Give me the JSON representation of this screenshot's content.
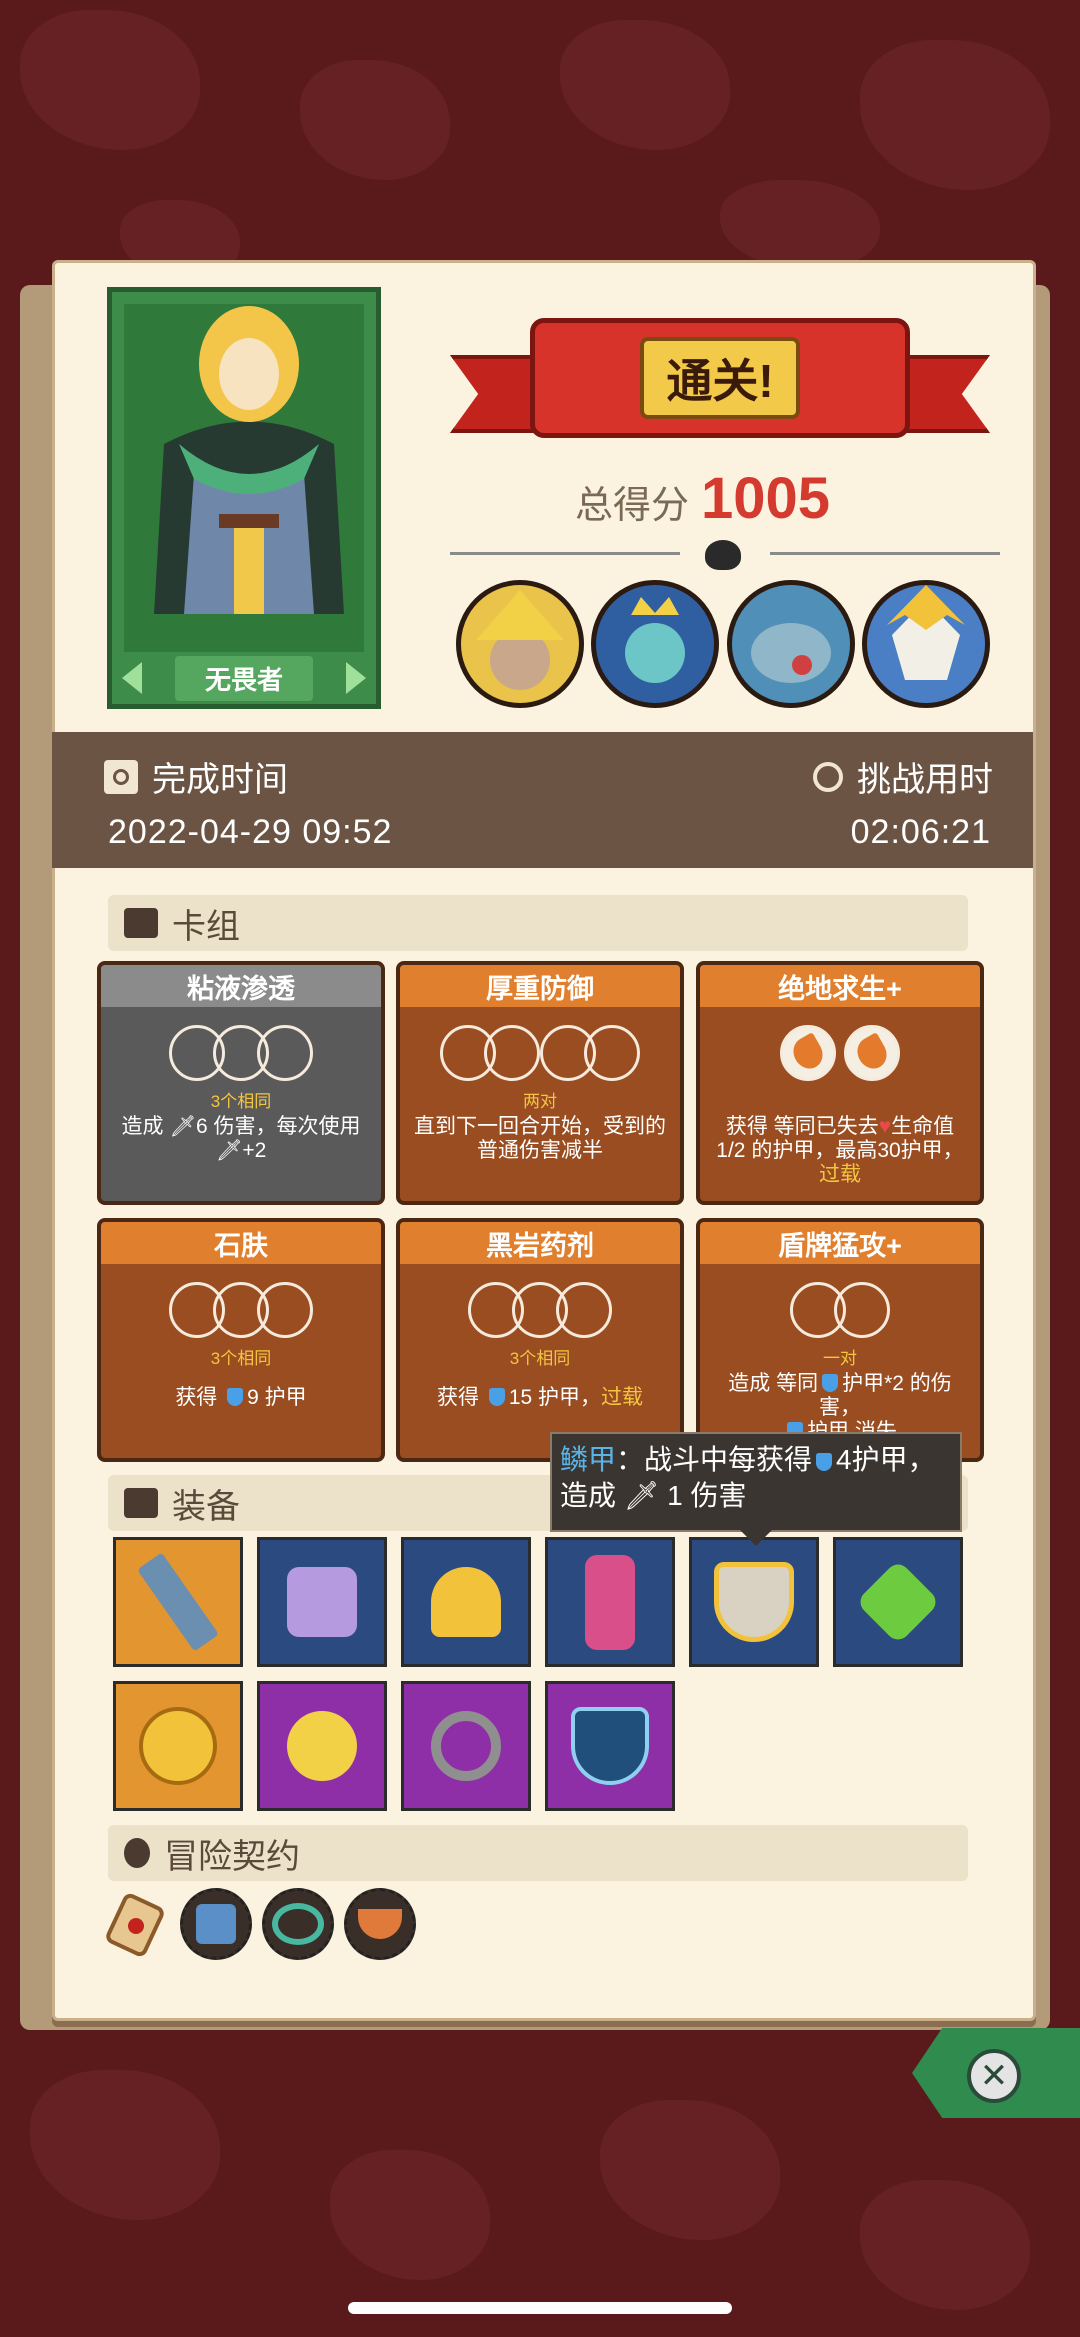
{
  "hero": {
    "name": "无畏者"
  },
  "result": {
    "banner": "通关!",
    "score_label": "总得分",
    "score_value": "1005"
  },
  "info": {
    "completion_time_label": "完成时间",
    "completion_time_value": "2022-04-29 09:52",
    "challenge_time_label": "挑战用时",
    "challenge_time_value": "02:06:21"
  },
  "deck": {
    "title": "卡组",
    "cards": [
      {
        "name": "粘液渗透",
        "rule": "3个相同",
        "desc_a": "造成 ",
        "desc_b": "6 伤害，每次使用",
        "desc_c": "+2"
      },
      {
        "name": "厚重防御",
        "rule": "两对",
        "desc": "直到下一回合开始，受到的普通伤害减半"
      },
      {
        "name": "绝地求生+",
        "desc_a": "获得 等同已失去",
        "desc_b": "生命值 1/2 的护甲，最高30护甲，",
        "desc_c": "过载"
      },
      {
        "name": "石肤",
        "rule": "3个相同",
        "desc_a": "获得 ",
        "desc_b": "9 护甲"
      },
      {
        "name": "黑岩药剂",
        "rule": "3个相同",
        "desc_a": "获得 ",
        "desc_b": "15 护甲，",
        "desc_c": "过载"
      },
      {
        "name": "盾牌猛攻+",
        "rule": "一对",
        "desc_a": "造成 等同",
        "desc_b": "护甲*2 的伤害，",
        "desc_c": "护甲 消失"
      }
    ]
  },
  "equipment": {
    "title": "装备",
    "tooltip": {
      "name": "鳞甲",
      "line1": "：战斗中每获得",
      "line1b": "4护甲，",
      "line2a": "造成 ",
      "line2b": "1 伤害"
    }
  },
  "contracts": {
    "title": "冒险契约"
  },
  "colors": {
    "banner_red": "#d8332a",
    "score_red": "#d43a2e",
    "card_orange": "#e07f2e",
    "card_grey": "#8b8b8b",
    "keyword_yellow": "#f4c542"
  }
}
